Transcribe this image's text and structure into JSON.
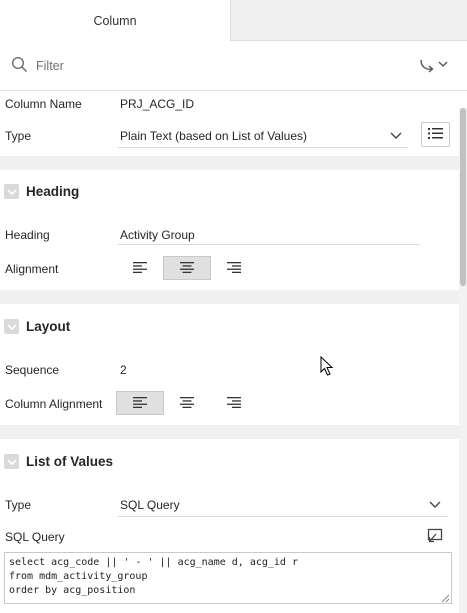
{
  "tabs": [
    {
      "label": "Column"
    }
  ],
  "filter": {
    "placeholder": "Filter"
  },
  "properties": {
    "column_name": {
      "label": "Column Name",
      "value": "PRJ_ACG_ID"
    },
    "type": {
      "label": "Type",
      "value": "Plain Text (based on List of Values)"
    }
  },
  "heading_section": {
    "title": "Heading",
    "heading": {
      "label": "Heading",
      "value": "Activity Group"
    },
    "alignment": {
      "label": "Alignment",
      "selected": "center"
    }
  },
  "layout_section": {
    "title": "Layout",
    "sequence": {
      "label": "Sequence",
      "value": "2"
    },
    "column_alignment": {
      "label": "Column Alignment",
      "selected": "left"
    }
  },
  "lov_section": {
    "title": "List of Values",
    "type": {
      "label": "Type",
      "value": "SQL Query"
    },
    "sql_query": {
      "label": "SQL Query",
      "value": "select acg_code || ' - ' || acg_name d, acg_id r\nfrom mdm_activity_group\norder by acg_position"
    }
  },
  "icons": [
    "search-icon",
    "go-to-group-icon",
    "chevron-down-icon",
    "list-icon",
    "align-left-icon",
    "align-center-icon",
    "align-right-icon",
    "expand-editor-icon"
  ]
}
